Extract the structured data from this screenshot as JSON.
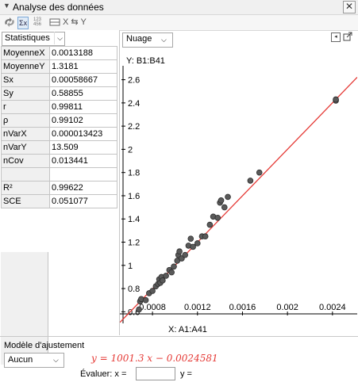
{
  "window": {
    "title": "Analyse des données",
    "collapse_icon": "triangle-down-icon",
    "close_icon": "close-icon"
  },
  "toolbar": {
    "icons": [
      "settings-icon",
      "sigma-stats-icon",
      "table-icon",
      "data-sheet-icon",
      "swap-xy-icon"
    ],
    "sum_label": "Σx",
    "num_label": "123 456",
    "swap_label": "X ⇆ Y"
  },
  "stats": {
    "selector": "Statistiques",
    "rows": [
      {
        "name": "MoyenneX",
        "value": "0.0013188"
      },
      {
        "name": "MoyenneY",
        "value": "1.3181"
      },
      {
        "name": "Sx",
        "value": "0.00058667"
      },
      {
        "name": "Sy",
        "value": "0.58855"
      },
      {
        "name": "r",
        "value": "0.99811"
      },
      {
        "name": "ρ",
        "value": "0.99102"
      },
      {
        "name": "nVarX",
        "value": "0.000013423"
      },
      {
        "name": "nVarY",
        "value": "13.509"
      },
      {
        "name": "nCov",
        "value": "0.013441"
      },
      {
        "name": "",
        "value": ""
      },
      {
        "name": "R²",
        "value": "0.99622"
      },
      {
        "name": "SCE",
        "value": "0.051077"
      }
    ]
  },
  "plot": {
    "selector": "Nuage",
    "y_label": "Y:  B1:B41",
    "x_label": "X:  A1:A41",
    "tool_icons": [
      "arrow-left-box-icon",
      "export-icon"
    ]
  },
  "model": {
    "label": "Modèle d'ajustement",
    "selector": "Aucun",
    "equation": "y = 1001.3 x − 0.0024581",
    "evaluate_label": "Évaluer:  x =",
    "x_value": "",
    "y_label": "y ="
  },
  "colors": {
    "fit_line": "#e53935",
    "points": "#5a5a5a",
    "panel_bg": "#f0f0f0"
  },
  "chart_data": {
    "type": "scatter",
    "title": "",
    "xlabel": "X:  A1:A41",
    "ylabel": "Y:  B1:B41",
    "xlim": [
      0.00051,
      0.00262
    ],
    "ylim": [
      0.5,
      2.72
    ],
    "x_ticks": [
      0.0008,
      0.0012,
      0.0016,
      0.002,
      0.0024
    ],
    "x_tick_labels": [
      "0.0008",
      "0.0012",
      "0.0016",
      "0.002",
      "0.0024"
    ],
    "y_ticks": [
      0.6,
      0.8,
      1,
      1.2,
      1.4,
      1.6,
      1.8,
      2,
      2.2,
      2.4,
      2.6
    ],
    "y_tick_labels": [
      "0.6",
      "0.8",
      "1",
      "1.2",
      "1.4",
      "1.6",
      "1.8",
      "2",
      "2.2",
      "2.4",
      "2.6"
    ],
    "points": [
      [
        0.00068,
        0.62
      ],
      [
        0.00069,
        0.69
      ],
      [
        0.0007,
        0.71
      ],
      [
        0.00074,
        0.7
      ],
      [
        0.00077,
        0.76
      ],
      [
        0.0008,
        0.78
      ],
      [
        0.00083,
        0.82
      ],
      [
        0.00085,
        0.84
      ],
      [
        0.00086,
        0.88
      ],
      [
        0.00087,
        0.85
      ],
      [
        0.00088,
        0.9
      ],
      [
        0.00089,
        0.87
      ],
      [
        0.00092,
        0.91
      ],
      [
        0.00095,
        0.96
      ],
      [
        0.00097,
        0.94
      ],
      [
        0.00099,
        0.99
      ],
      [
        0.00102,
        1.04
      ],
      [
        0.00103,
        1.09
      ],
      [
        0.00104,
        1.12
      ],
      [
        0.00106,
        1.06
      ],
      [
        0.00109,
        1.09
      ],
      [
        0.00112,
        1.17
      ],
      [
        0.00114,
        1.23
      ],
      [
        0.00116,
        1.16
      ],
      [
        0.0012,
        1.19
      ],
      [
        0.00124,
        1.25
      ],
      [
        0.00127,
        1.25
      ],
      [
        0.00131,
        1.35
      ],
      [
        0.00134,
        1.42
      ],
      [
        0.00138,
        1.41
      ],
      [
        0.0014,
        1.54
      ],
      [
        0.00141,
        1.56
      ],
      [
        0.00144,
        1.5
      ],
      [
        0.00147,
        1.59
      ],
      [
        0.00167,
        1.73
      ],
      [
        0.00175,
        1.8
      ],
      [
        0.00243,
        2.42
      ],
      [
        0.00243,
        2.43
      ]
    ],
    "fit": {
      "slope": 1001.3,
      "intercept": -0.0024581
    },
    "grid": false,
    "legend": "none"
  }
}
